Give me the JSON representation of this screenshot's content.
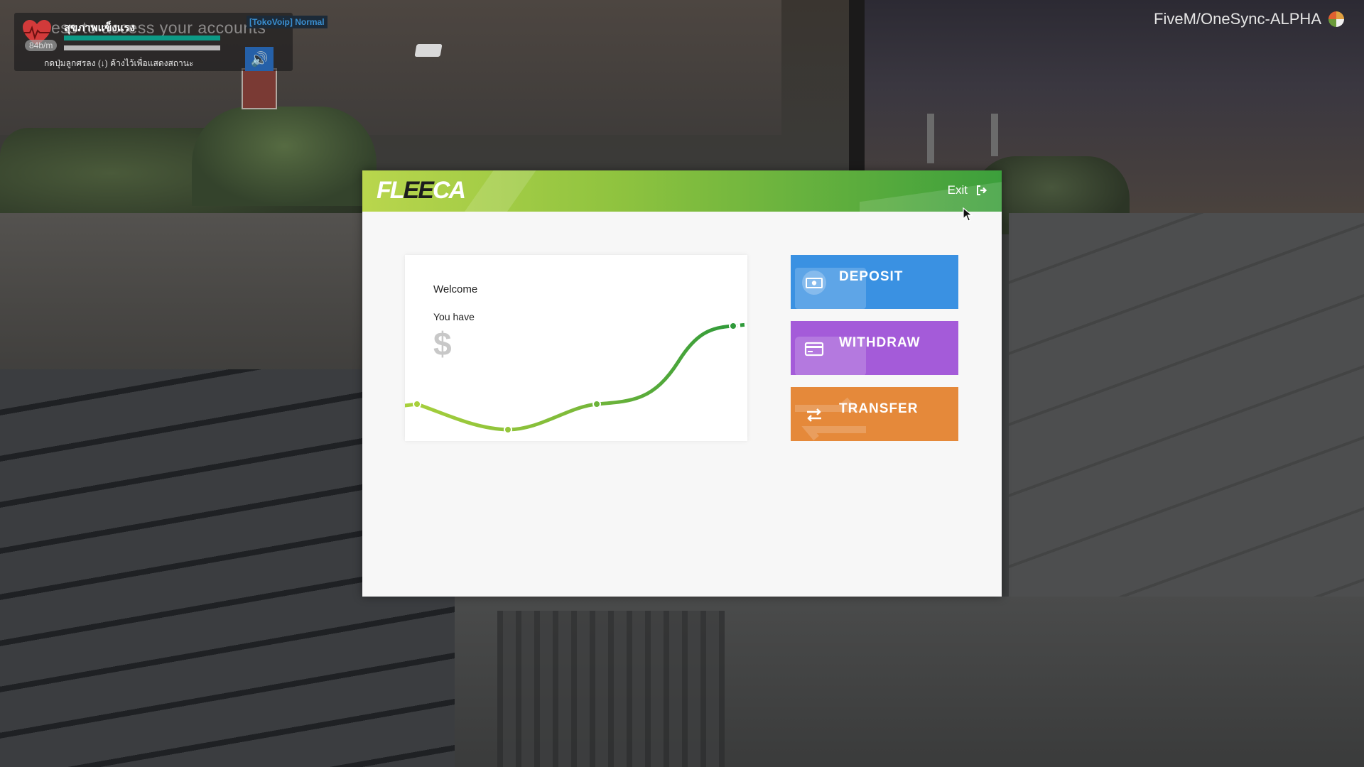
{
  "hud": {
    "status_label": "สุขภาพแข็งแรง",
    "overlay_text": "ess to access your accounts",
    "bpm": "84b/m",
    "hint": "กดปุ่มลูกศรลง (↓) ค้างไว้เพื่อแสดงสถานะ",
    "voip_mode": "[TokoVoip] Normal",
    "server_name": "FiveM/OneSync-ALPHA"
  },
  "bank": {
    "brand_prefix": "FL",
    "brand_mid": "EE",
    "brand_suffix": "CA",
    "exit_label": "Exit",
    "welcome_text": "Welcome",
    "balance_label": "You have",
    "currency_symbol": "$",
    "actions": {
      "deposit_label": "DEPOSIT",
      "withdraw_label": "WITHDRAW",
      "transfer_label": "TRANSFER"
    }
  },
  "colors": {
    "header_start": "#b9d64d",
    "header_end": "#3c9f3c",
    "deposit": "#3a91e2",
    "withdraw": "#a45bd9",
    "transfer": "#e5893a",
    "line_light": "#9cc93c",
    "line_dark": "#3a9a3a"
  },
  "icons": {
    "deposit": "cash-icon",
    "withdraw": "card-icon",
    "transfer": "swap-arrows-icon",
    "exit": "sign-out-icon"
  }
}
